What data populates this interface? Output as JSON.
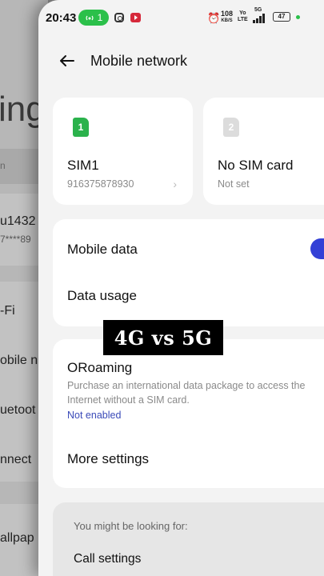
{
  "status_bar": {
    "time": "20:43",
    "hotspot_count": "1",
    "net_speed_value": "108",
    "net_speed_unit": "KB/S",
    "volte": "Yo\nLTE",
    "signal": "5G",
    "battery": "47"
  },
  "background": {
    "big_text": "ing",
    "search_hint": "n",
    "account_name": "u1432",
    "account_sub": "7****89",
    "items": [
      "-Fi",
      "obile n",
      "uetoot",
      "nnect",
      "allpap"
    ]
  },
  "header": {
    "title": "Mobile network"
  },
  "sims": [
    {
      "slot": "1",
      "name": "SIM1",
      "sub": "916375878930",
      "color": "#2bb24c"
    },
    {
      "slot": "2",
      "name": "No SIM card",
      "sub": "Not set",
      "color": "#d9d9d9"
    }
  ],
  "data_card": {
    "mobile_data_label": "Mobile data",
    "mobile_data_on": true,
    "data_usage_label": "Data usage"
  },
  "overlay": {
    "text": "4G vs 5G"
  },
  "roaming_card": {
    "title": "ORoaming",
    "description": "Purchase an international data package to access the Internet without a SIM card.",
    "status": "Not enabled",
    "more_settings": "More settings"
  },
  "suggestions": {
    "title": "You might be looking for:",
    "items": [
      "Call settings"
    ]
  },
  "colors": {
    "accent": "#3340d6",
    "sim_active": "#2bb24c",
    "link": "#3a4ab8"
  }
}
